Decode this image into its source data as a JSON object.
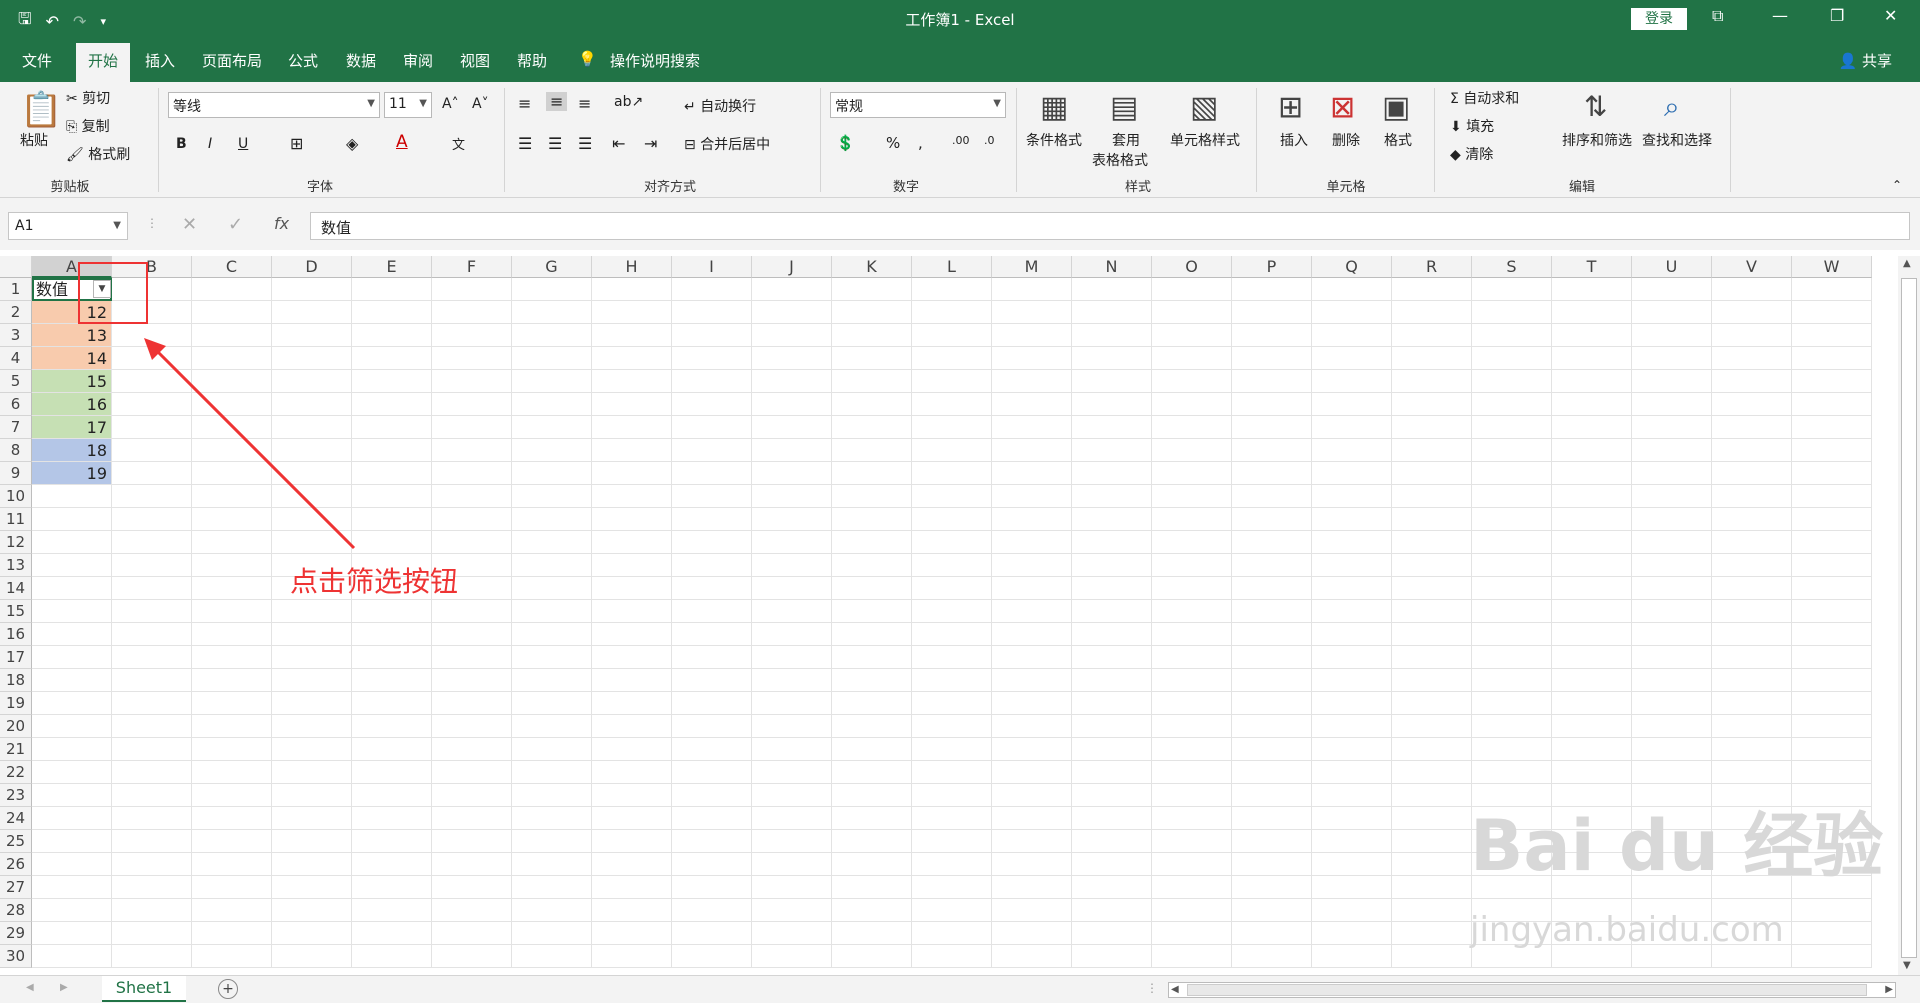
{
  "window": {
    "title": "工作簿1  -  Excel",
    "login_label": "登录"
  },
  "tabs": [
    {
      "label": "文件"
    },
    {
      "label": "开始"
    },
    {
      "label": "插入"
    },
    {
      "label": "页面布局"
    },
    {
      "label": "公式"
    },
    {
      "label": "数据"
    },
    {
      "label": "审阅"
    },
    {
      "label": "视图"
    },
    {
      "label": "帮助"
    },
    {
      "label": "操作说明搜索"
    }
  ],
  "share_label": "共享",
  "ribbon": {
    "clipboard": {
      "paste": "粘贴",
      "cut": "剪切",
      "copy": "复制",
      "format_painter": "格式刷",
      "label": "剪贴板"
    },
    "font": {
      "name": "等线",
      "size": "11",
      "bold": "B",
      "italic": "I",
      "underline": "U",
      "label": "字体"
    },
    "alignment": {
      "wrap": "自动换行",
      "merge": "合并后居中",
      "label": "对齐方式"
    },
    "number": {
      "format": "常规",
      "label": "数字"
    },
    "styles": {
      "conditional": "条件格式",
      "table_line1": "套用",
      "table_line2": "表格格式",
      "cell_styles": "单元格样式",
      "label": "样式"
    },
    "cells": {
      "insert": "插入",
      "delete": "删除",
      "format": "格式",
      "label": "单元格"
    },
    "editing": {
      "autosum": "自动求和",
      "fill": "填充",
      "clear": "清除",
      "sort": "排序和筛选",
      "find": "查找和选择",
      "label": "编辑"
    }
  },
  "formula": {
    "name_box": "A1",
    "content": "数值"
  },
  "columns": [
    "A",
    "B",
    "C",
    "D",
    "E",
    "F",
    "G",
    "H",
    "I",
    "J",
    "K",
    "L",
    "M",
    "N",
    "O",
    "P",
    "Q",
    "R",
    "S",
    "T",
    "U",
    "V",
    "W"
  ],
  "rows": [
    "1",
    "2",
    "3",
    "4",
    "5",
    "6",
    "7",
    "8",
    "9",
    "10",
    "11",
    "12",
    "13",
    "14",
    "15",
    "16",
    "17",
    "18",
    "19",
    "20",
    "21",
    "22",
    "23",
    "24",
    "25",
    "26",
    "27",
    "28",
    "29",
    "30"
  ],
  "cells": {
    "header": "数值",
    "values": [
      {
        "v": "12",
        "color": "#f8cbad"
      },
      {
        "v": "13",
        "color": "#f8cbad"
      },
      {
        "v": "14",
        "color": "#f8cbad"
      },
      {
        "v": "15",
        "color": "#c6e0b4"
      },
      {
        "v": "16",
        "color": "#c6e0b4"
      },
      {
        "v": "17",
        "color": "#c6e0b4"
      },
      {
        "v": "18",
        "color": "#b4c6e7"
      },
      {
        "v": "19",
        "color": "#b4c6e7"
      }
    ]
  },
  "annotation": "点击筛选按钮",
  "sheet_tab": "Sheet1",
  "watermark": {
    "line1": "Bai du 经验",
    "line2": "jingyan.baidu.com"
  }
}
